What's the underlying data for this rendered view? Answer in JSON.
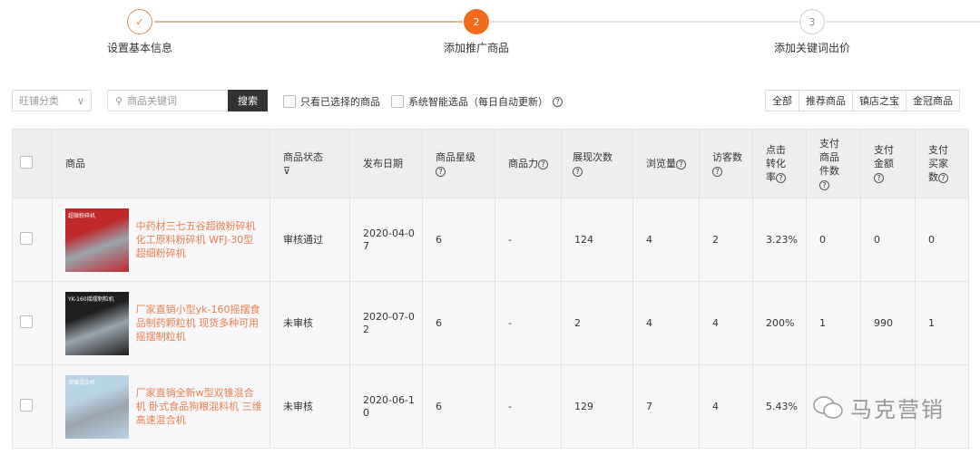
{
  "steps": [
    {
      "label": "设置基本信息",
      "num": "✓"
    },
    {
      "label": "添加推广商品",
      "num": "2"
    },
    {
      "label": "添加关键词出价",
      "num": "3"
    }
  ],
  "filters": {
    "category": "旺铺分类",
    "search_placeholder": "商品关键词",
    "search_button": "搜索",
    "only_selected": "只看已选择的商品",
    "smart_select": "系统智能选品（每日自动更新）",
    "segments": [
      "全部",
      "推荐商品",
      "镇店之宝",
      "金冠商品"
    ]
  },
  "columns": [
    "商品",
    "商品状态",
    "发布日期",
    "商品星级",
    "商品力",
    "展现次数",
    "浏览量",
    "访客数",
    "点击转化率",
    "支付商品件数",
    "支付金额",
    "支付买家数"
  ],
  "rows": [
    {
      "name": "中药材三七五谷超微粉碎机 化工原料粉碎机 WFJ-30型超细粉碎机",
      "status": "审核通过",
      "date": "2020-04-07",
      "star": "6",
      "power": "-",
      "impressions": "124",
      "views": "4",
      "visitors": "2",
      "ctr": "3.23%",
      "items": "0",
      "amount": "0",
      "buyers": "0",
      "thumb_title": "超微粉碎机",
      "thumb_color": "#c0282a"
    },
    {
      "name": "厂家直销小型yk-160摇摆食品制药颗粒机 现货多种可用摇摆制粒机",
      "status": "未审核",
      "date": "2020-07-02",
      "star": "6",
      "power": "-",
      "impressions": "2",
      "views": "4",
      "visitors": "4",
      "ctr": "200%",
      "items": "1",
      "amount": "990",
      "buyers": "1",
      "thumb_title": "YK-160摇摆制粒机",
      "thumb_color": "#1e1e1e"
    },
    {
      "name": "厂家直销全新w型双锥混合机 卧式食品狗粮混料机 三维高速混合机",
      "status": "未审核",
      "date": "2020-06-10",
      "star": "6",
      "power": "-",
      "impressions": "129",
      "views": "7",
      "visitors": "4",
      "ctr": "5.43%",
      "items": "",
      "amount": "",
      "buyers": "",
      "thumb_title": "双锥混合机",
      "thumb_color": "#b9d3e6"
    }
  ],
  "watermark": "马克营销",
  "accent": "#f26b1d"
}
